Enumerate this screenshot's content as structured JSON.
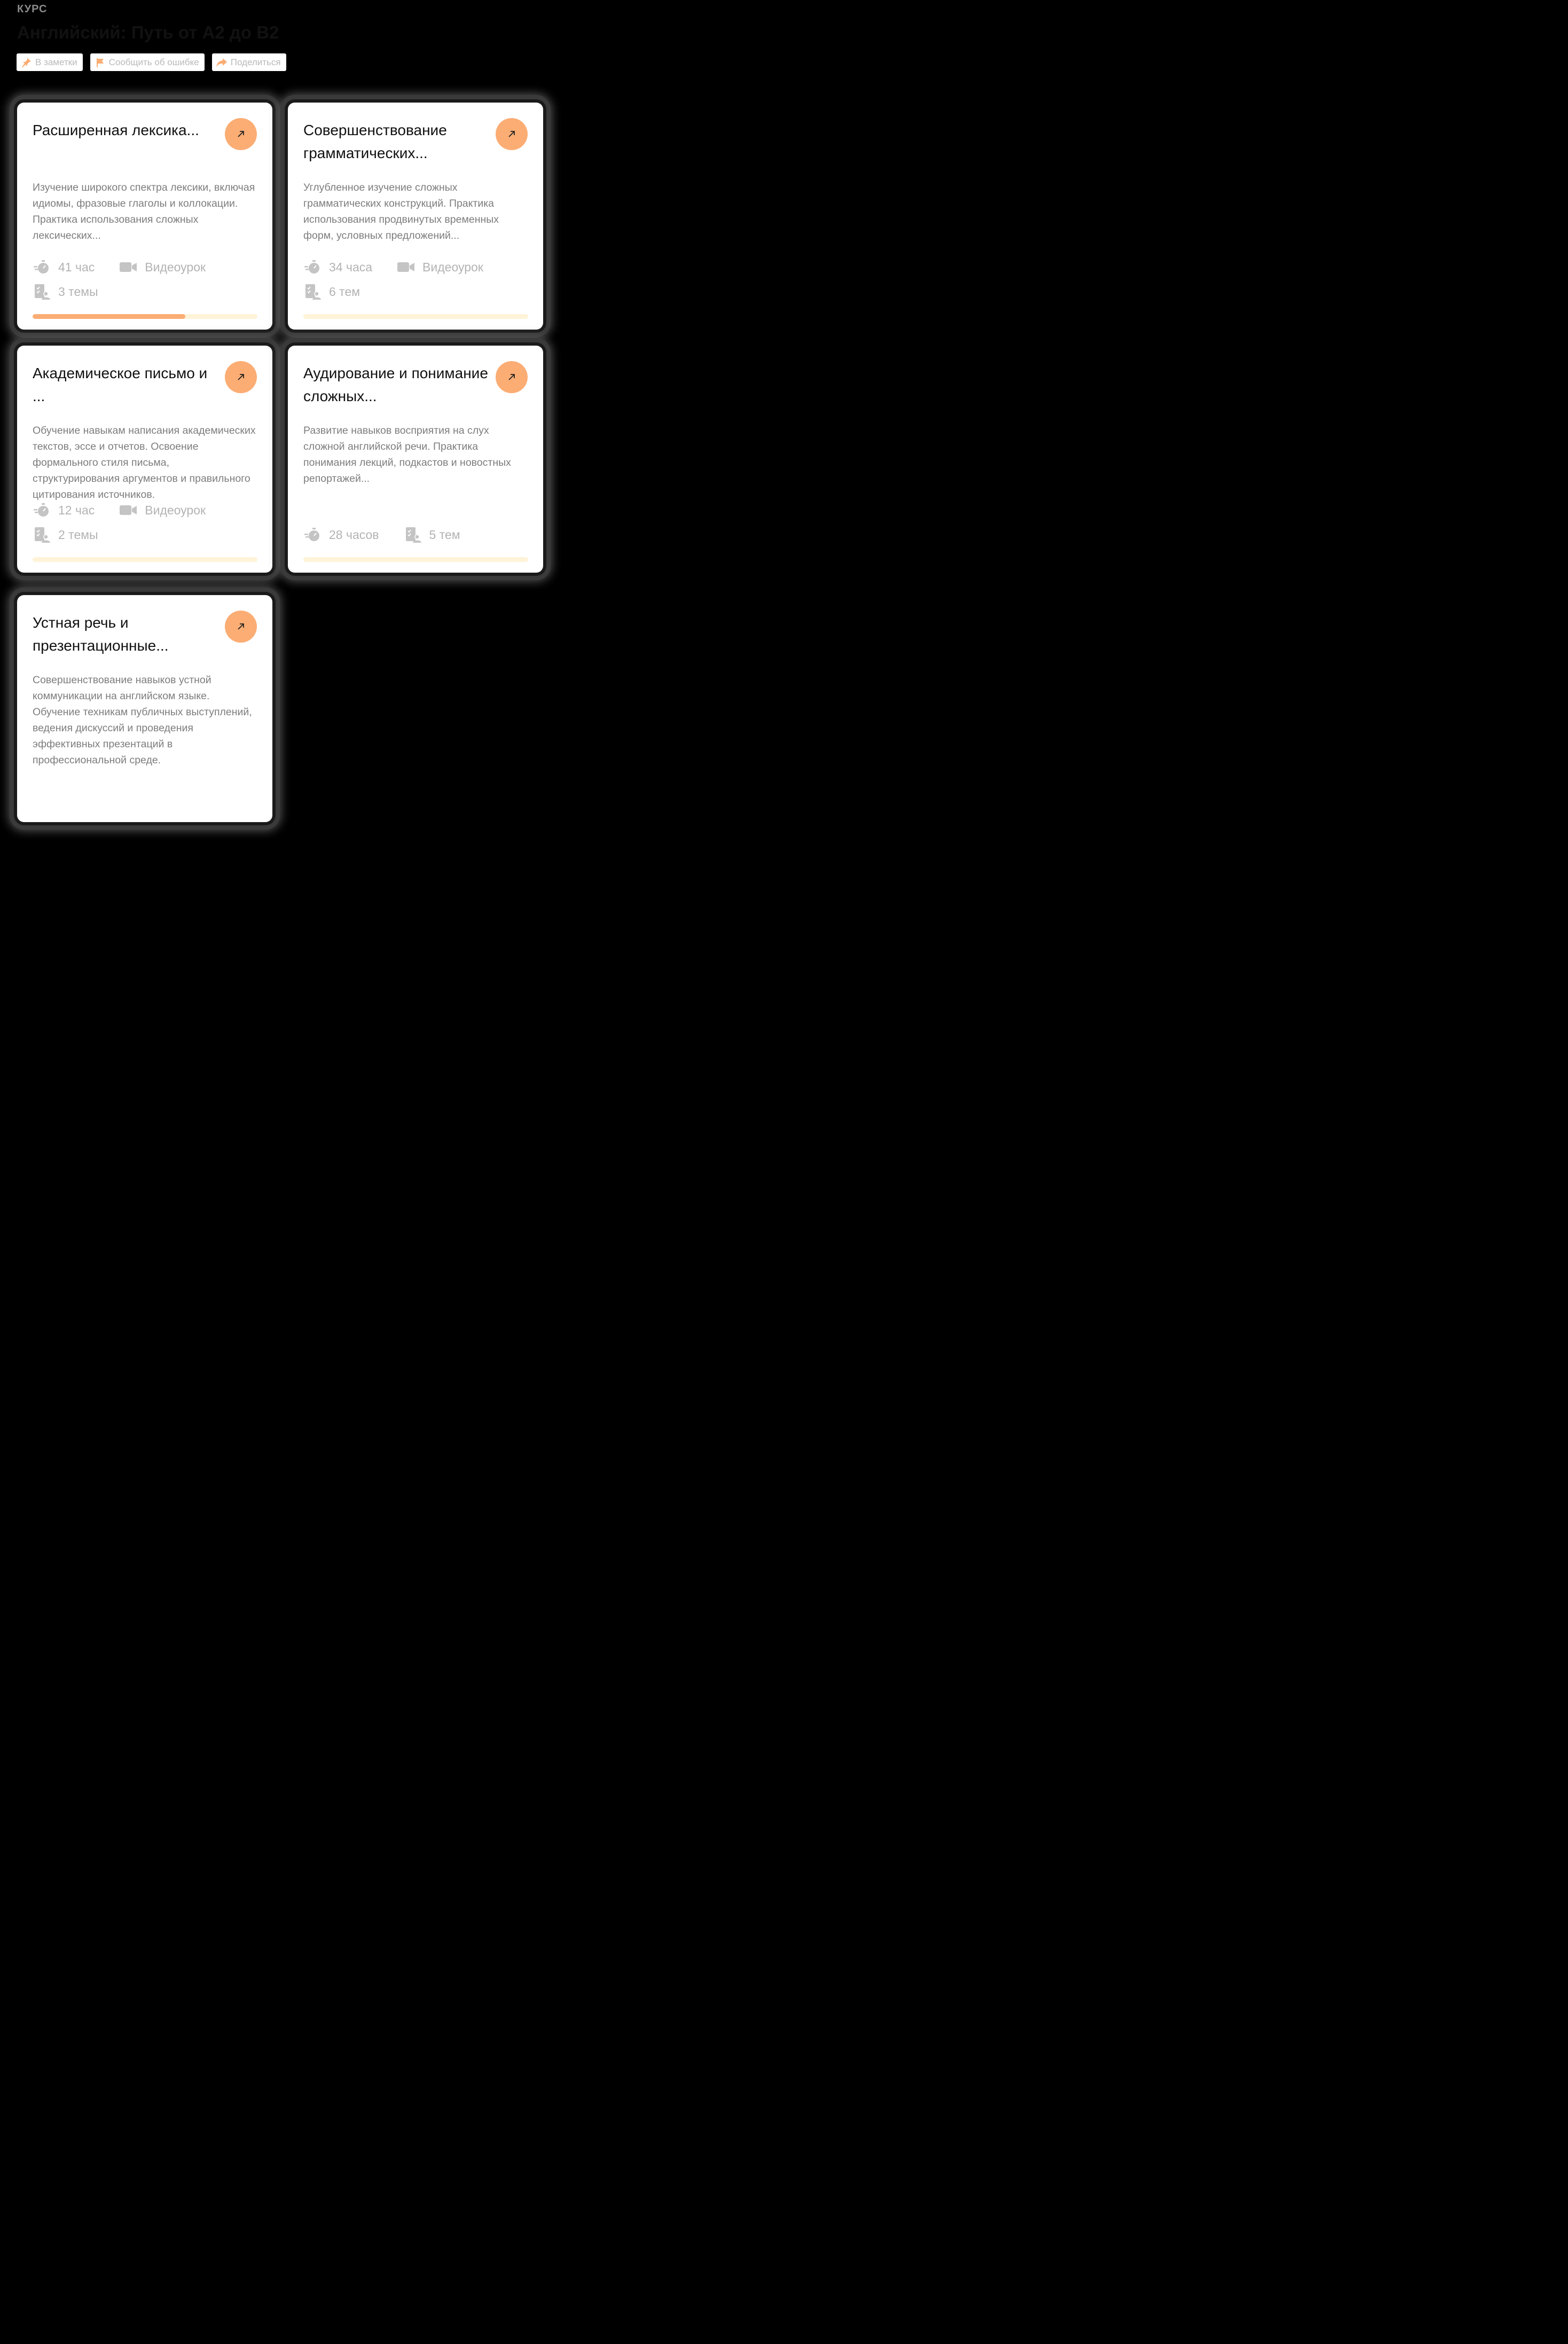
{
  "header": {
    "eyebrow": "КУРС",
    "title": "Английский: Путь от A2 до B2"
  },
  "actions": [
    {
      "label": "В заметки",
      "icon": "pin-icon"
    },
    {
      "label": "Сообщить об ошибке",
      "icon": "flag-icon"
    },
    {
      "label": "Поделиться",
      "icon": "share-icon"
    }
  ],
  "colors": {
    "accent": "#fbad74",
    "track": "#fff3d9",
    "muted": "#b3b3b3"
  },
  "cards": [
    {
      "title": "Расширенная лексика...",
      "description": "Изучение широкого спектра лексики, включая идиомы, фразовые глаголы и коллокации. Практика использования сложных лексических...",
      "hours": "41 час",
      "format": "Видеоурок",
      "topics": "3 темы",
      "progress": 0.68
    },
    {
      "title": "Совершенствование грамматических...",
      "description": "Углубленное изучение сложных грамматических конструкций. Практика использования продвинутых временных форм, условных предложений...",
      "hours": "34 часа",
      "format": "Видеоурок",
      "topics": "6 тем",
      "progress": 0
    },
    {
      "title": "Академическое письмо и ...",
      "description": "Обучение навыкам написания академических текстов, эссе и отчетов. Освоение формального стиля письма, структурирования аргументов и правильного цитирования источников.",
      "hours": "12 час",
      "format": "Видеоурок",
      "topics": "2 темы",
      "progress": 0
    },
    {
      "title": "Аудирование и понимание сложных...",
      "description": "Развитие навыков восприятия на слух сложной английской речи. Практика понимания лекций, подкастов и новостных репортажей...",
      "hours": "28 часов",
      "topics": "5 тем",
      "progress": 0
    },
    {
      "title": "Устная речь и презентационные...",
      "description": "Совершенствование навыков устной коммуникации на английском языке. Обучение техникам публичных выступлений, ведения дискуссий и проведения эффективных презентаций в профессиональной среде."
    }
  ]
}
